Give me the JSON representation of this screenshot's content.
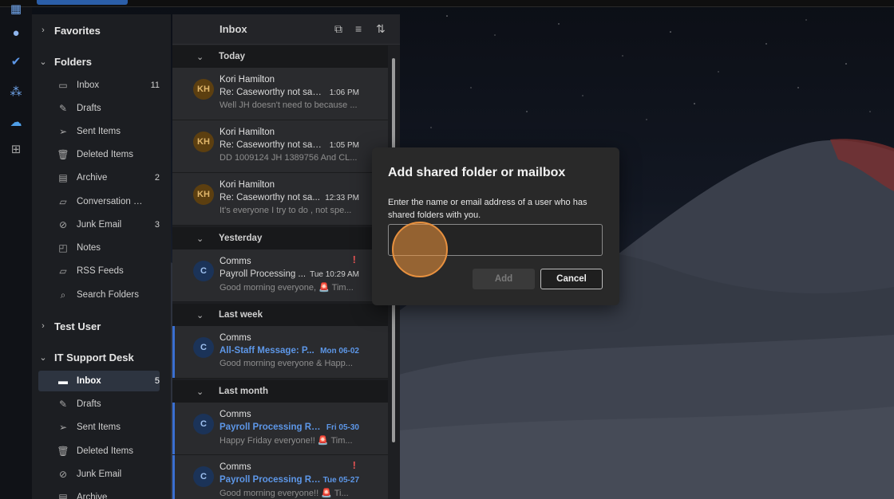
{
  "colors": {
    "accent": "#3a6fd1",
    "unread_blue": "#5d97e8",
    "flag_red": "#e25252",
    "cursor_orange": "#e8913f"
  },
  "rail": {
    "icons": [
      "calendar-icon",
      "people-icon",
      "todo-check-icon",
      "groups-icon",
      "onedrive-cloud-icon",
      "apps-grid-icon"
    ]
  },
  "folders": {
    "favorites_label": "Favorites",
    "folders_label": "Folders",
    "folder_items": [
      {
        "label": "Inbox",
        "count": "11",
        "icon": "inbox-icon"
      },
      {
        "label": "Drafts",
        "count": "",
        "icon": "pencil-icon"
      },
      {
        "label": "Sent Items",
        "count": "",
        "icon": "send-icon"
      },
      {
        "label": "Deleted Items",
        "count": "",
        "icon": "trash-icon"
      },
      {
        "label": "Archive",
        "count": "2",
        "icon": "archive-icon"
      },
      {
        "label": "Conversation Histo...",
        "count": "",
        "icon": "folder-icon"
      },
      {
        "label": "Junk Email",
        "count": "3",
        "icon": "junk-icon"
      },
      {
        "label": "Notes",
        "count": "",
        "icon": "notes-icon"
      },
      {
        "label": "RSS Feeds",
        "count": "",
        "icon": "folder-icon"
      },
      {
        "label": "Search Folders",
        "count": "",
        "icon": "search-folder-icon"
      }
    ],
    "test_user_label": "Test User",
    "it_support_label": "IT Support Desk",
    "it_items": [
      {
        "label": "Inbox",
        "count": "5",
        "icon": "inbox-icon"
      },
      {
        "label": "Drafts",
        "count": "",
        "icon": "pencil-icon"
      },
      {
        "label": "Sent Items",
        "count": "",
        "icon": "send-icon"
      },
      {
        "label": "Deleted Items",
        "count": "",
        "icon": "trash-icon"
      },
      {
        "label": "Junk Email",
        "count": "",
        "icon": "junk-icon"
      },
      {
        "label": "Archive",
        "count": "",
        "icon": "archive-icon"
      }
    ]
  },
  "message_list": {
    "title": "Inbox",
    "sections": [
      "Today",
      "Yesterday",
      "Last week",
      "Last month"
    ],
    "messages": [
      {
        "avatar": "KH",
        "from": "Kori Hamilton",
        "subject": "Re: Caseworthy not savi...",
        "time": "1:06 PM",
        "preview": "Well JH doesn't need to because ..."
      },
      {
        "avatar": "KH",
        "from": "Kori Hamilton",
        "subject": "Re: Caseworthy not savi...",
        "time": "1:05 PM",
        "preview": "DD 1009124 JH 1389756 And CL..."
      },
      {
        "avatar": "KH",
        "from": "Kori Hamilton",
        "subject": "Re: Caseworthy not sa...",
        "time": "12:33 PM",
        "preview": "It's everyone I try to do , not spe..."
      },
      {
        "avatar": "C",
        "from": "Comms",
        "subject": "Payroll Processing ...",
        "time": "Tue 10:29 AM",
        "preview": "Good morning everyone, 🚨 Tim..."
      },
      {
        "avatar": "C",
        "from": "Comms",
        "subject": "All-Staff Message: P...",
        "time": "Mon 06-02",
        "preview": "Good morning everyone & Happ..."
      },
      {
        "avatar": "C",
        "from": "Comms",
        "subject": "Payroll Processing Re...",
        "time": "Fri 05-30",
        "preview": "Happy Friday everyone!! 🚨 Tim..."
      },
      {
        "avatar": "C",
        "from": "Comms",
        "subject": "Payroll Processing Re...",
        "time": "Tue 05-27",
        "preview": "Good morning everyone!! 🚨 Ti..."
      }
    ]
  },
  "dialog": {
    "title": "Add shared folder or mailbox",
    "description": "Enter the name or email address of a user who has shared folders with you.",
    "input_value": "",
    "add_label": "Add",
    "cancel_label": "Cancel"
  }
}
